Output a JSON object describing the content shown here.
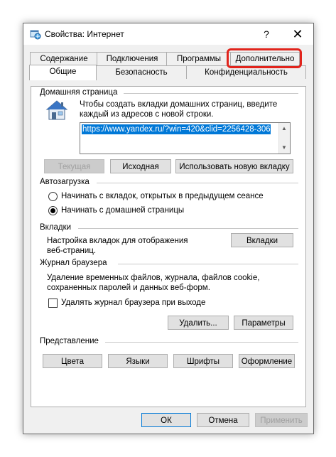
{
  "window": {
    "title": "Свойства: Интернет",
    "help_glyph": "?",
    "close_glyph": "✕"
  },
  "tabs": {
    "row1": [
      "Содержание",
      "Подключения",
      "Программы",
      "Дополнительно"
    ],
    "row2": [
      "Общие",
      "Безопасность",
      "Конфиденциальность"
    ],
    "active": "Общие",
    "highlighted": "Дополнительно",
    "highlight_color": "#e1241c"
  },
  "homepage": {
    "group_title": "Домашняя страница",
    "description": [
      "Чтобы создать вкладки домашних страниц, введите",
      "каждый из адресов с новой строки."
    ],
    "url": "https://www.yandex.ru/?win=420&clid=2256428-306",
    "buttons": {
      "current": "Текущая",
      "default": "Исходная",
      "new_tab": "Использовать новую вкладку"
    }
  },
  "startup": {
    "group_title": "Автозагрузка",
    "option_last": "Начинать с вкладок, открытых в предыдущем сеансе",
    "option_home": "Начинать с домашней страницы",
    "selected": "option_home"
  },
  "tabs_group": {
    "group_title": "Вкладки",
    "description": [
      "Настройка вкладок для отображения",
      "веб-страниц."
    ],
    "button": "Вкладки"
  },
  "history": {
    "group_title": "Журнал браузера",
    "description": [
      "Удаление временных файлов, журнала, файлов cookie,",
      "сохраненных паролей и данных веб-форм."
    ],
    "checkbox_label": "Удалять журнал браузера при выходе",
    "checkbox_checked": false,
    "delete_button": "Удалить...",
    "settings_button": "Параметры"
  },
  "appearance": {
    "group_title": "Представление",
    "buttons": [
      "Цвета",
      "Языки",
      "Шрифты",
      "Оформление"
    ]
  },
  "footer": {
    "ok": "ОК",
    "cancel": "Отмена",
    "apply": "Применить"
  },
  "colors": {
    "accent": "#0078d7",
    "window_bg": "#f0f0f0",
    "panel_bg": "#ffffff"
  }
}
